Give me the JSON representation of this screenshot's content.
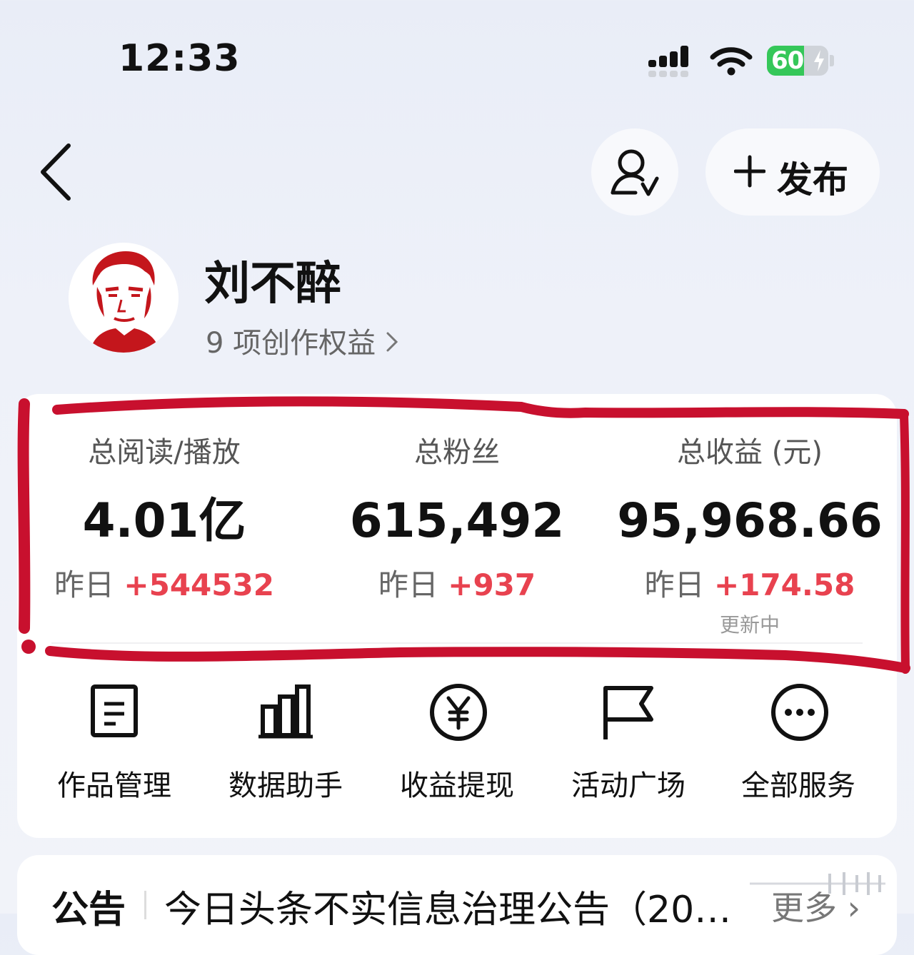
{
  "status_bar": {
    "time": "12:33",
    "battery_percent": "60",
    "battery_level": 0.6,
    "battery_charging": true,
    "battery_color": "#35c759",
    "signal_icon": "cellular-signal-icon",
    "wifi_icon": "wifi-icon"
  },
  "header": {
    "back_icon": "chevron-left-icon",
    "follow_icon": "user-check-icon",
    "publish_icon": "plus-icon",
    "publish_label": "发布"
  },
  "profile": {
    "name": "刘不醉",
    "benefits_link": "9 项创作权益",
    "avatar_icon": "avatar-portrait"
  },
  "stats": [
    {
      "label": "总阅读/播放",
      "value": "4.01亿",
      "delta_prefix": "昨日",
      "delta": "+544532"
    },
    {
      "label": "总粉丝",
      "value": "615,492",
      "delta_prefix": "昨日",
      "delta": "+937"
    },
    {
      "label": "总收益 (元)",
      "value": "95,968.66",
      "delta_prefix": "昨日",
      "delta": "+174.58",
      "note": "更新中"
    }
  ],
  "shortcuts": [
    {
      "label": "作品管理",
      "icon": "document-icon"
    },
    {
      "label": "数据助手",
      "icon": "bar-chart-icon"
    },
    {
      "label": "收益提现",
      "icon": "yuan-coin-icon"
    },
    {
      "label": "活动广场",
      "icon": "flag-icon"
    },
    {
      "label": "全部服务",
      "icon": "more-icon"
    }
  ],
  "notice": {
    "label": "公告",
    "text": "今日头条不实信息治理公告（20…",
    "more": "更多"
  },
  "colors": {
    "accent_red": "#e8424f",
    "annotation_red": "#c8102e",
    "card_bg": "#ffffff"
  }
}
